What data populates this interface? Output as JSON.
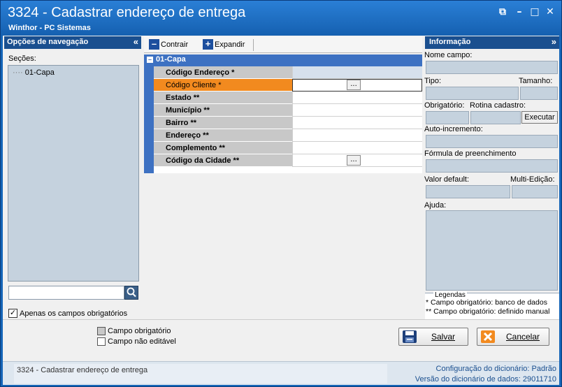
{
  "window": {
    "title": "3324 - Cadastrar endereço de entrega",
    "subtitle": "Winthor - PC Sistemas",
    "controls": {
      "restore": "⧉",
      "minimize": "–",
      "maximize": "□",
      "close": "✕"
    }
  },
  "nav": {
    "header": "Opções de navegação",
    "collapse_glyph": "«",
    "sections_label": "Seções:",
    "tree_items": [
      {
        "prefix": "····",
        "label": "01-Capa"
      }
    ],
    "search_value": "",
    "only_required_label": "Apenas os campos obrigatórios",
    "only_required_checked": "✓"
  },
  "toolbar": {
    "collapse_label": "Contrair",
    "expand_label": "Expandir",
    "collapse_icon": "–",
    "expand_icon": "+"
  },
  "grid": {
    "group_label": "01-Capa",
    "group_toggle": "–",
    "rows": [
      {
        "label": "Código Endereço *",
        "value": ""
      },
      {
        "label": "Código Cliente  *",
        "value": ""
      },
      {
        "label": "Estado **",
        "value": ""
      },
      {
        "label": "Município **",
        "value": ""
      },
      {
        "label": "Bairro **",
        "value": ""
      },
      {
        "label": "Endereço **",
        "value": ""
      },
      {
        "label": "Complemento **",
        "value": ""
      },
      {
        "label": "Código da Cidade **",
        "value": ""
      }
    ],
    "ellipsis": "..."
  },
  "info": {
    "header": "Informação",
    "collapse_glyph": "»",
    "field_name_label": "Nome campo:",
    "type_label": "Tipo:",
    "size_label": "Tamanho:",
    "required_label": "Obrigatório:",
    "routine_label": "Rotina cadastro:",
    "execute_label": "Executar",
    "autoinc_label": "Auto-incremento:",
    "formula_label": "Fórmula de preenchimento",
    "default_label": "Valor default:",
    "multiedit_label": "Multi-Edição:",
    "help_label": "Ajuda:",
    "legend_title": "Legendas",
    "legend_line1": "* Campo obrigatório: banco de dados",
    "legend_line2": "** Campo obrigatório: definido manual"
  },
  "legend": {
    "required": "Campo obrigatório",
    "readonly": "Campo não editável",
    "required_color": "#c8c8c8",
    "readonly_color": "#ffffff"
  },
  "actions": {
    "save_label": "Salvar",
    "cancel_label": "Cancelar"
  },
  "status": {
    "left": "3324 - Cadastrar endereço de entrega",
    "config_label": "Configuração do dicionário:",
    "config_value": "Padrão",
    "version_label": "Versão do dicionário de dados:",
    "version_value": "29011710"
  }
}
